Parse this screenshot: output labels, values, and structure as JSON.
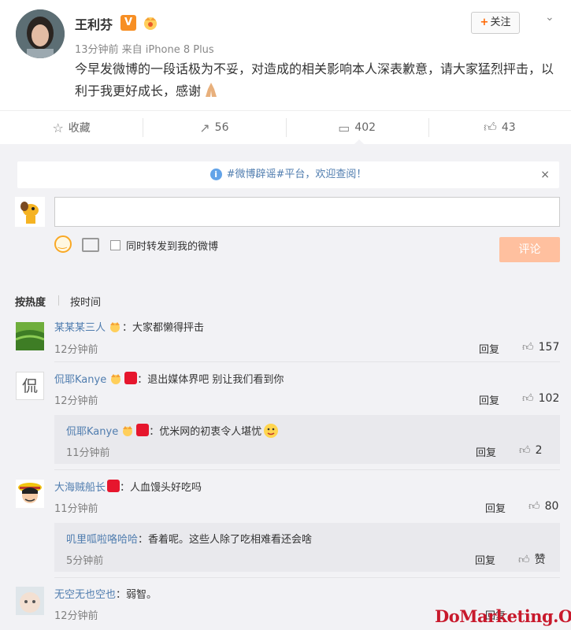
{
  "post": {
    "author": "王利芬",
    "vip_label": "V",
    "meta": "13分钟前 来自 iPhone 8 Plus",
    "text": "今早发微博的一段话极为不妥，对造成的相关影响本人深表歉意，请大家猛烈抨击，以利于我更好成长，感谢",
    "follow_label": "关注",
    "follow_plus": "+"
  },
  "actions": {
    "favorite": "收藏",
    "repost": "56",
    "comment": "402",
    "like": "43"
  },
  "notice": {
    "tag": "#微博辟谣#平台，",
    "link": "欢迎查阅！",
    "info": "i",
    "close": "×"
  },
  "composer": {
    "repost_label": "同时转发到我的微博",
    "submit_label": "评论"
  },
  "sort": {
    "hot": "按热度",
    "time": "按时间"
  },
  "comments": [
    {
      "user": "某某某三人",
      "text": "：大家都懒得抨击",
      "time": "12分钟前",
      "reply": "回复",
      "likes": "157"
    },
    {
      "user": "侃耶Kanye",
      "text": "：退出媒体界吧  别让我们看到你",
      "time": "12分钟前",
      "reply": "回复",
      "likes": "102",
      "sub": {
        "user": "侃耶Kanye",
        "text": "：优米网的初衷令人堪忧",
        "time": "11分钟前",
        "reply": "回复",
        "likes": "2"
      }
    },
    {
      "user": "大海贼船长",
      "text": "：人血馒头好吃吗",
      "time": "11分钟前",
      "reply": "回复",
      "likes": "80",
      "sub": {
        "user": "叽里呱啦咯哈哈",
        "text": "：香着呢。这些人除了吃相难看还会啥",
        "time": "5分钟前",
        "reply": "回复",
        "likes": "赞"
      }
    },
    {
      "user": "无空无也空也",
      "text": "：弱智。",
      "time": "12分钟前",
      "reply": "回复"
    }
  ],
  "watermark": "DoMarketing.Org",
  "colors": {
    "link": "#507daf",
    "submit": "#ffc09f",
    "background": "#f2f2f5",
    "watermark": "#c8192c"
  }
}
